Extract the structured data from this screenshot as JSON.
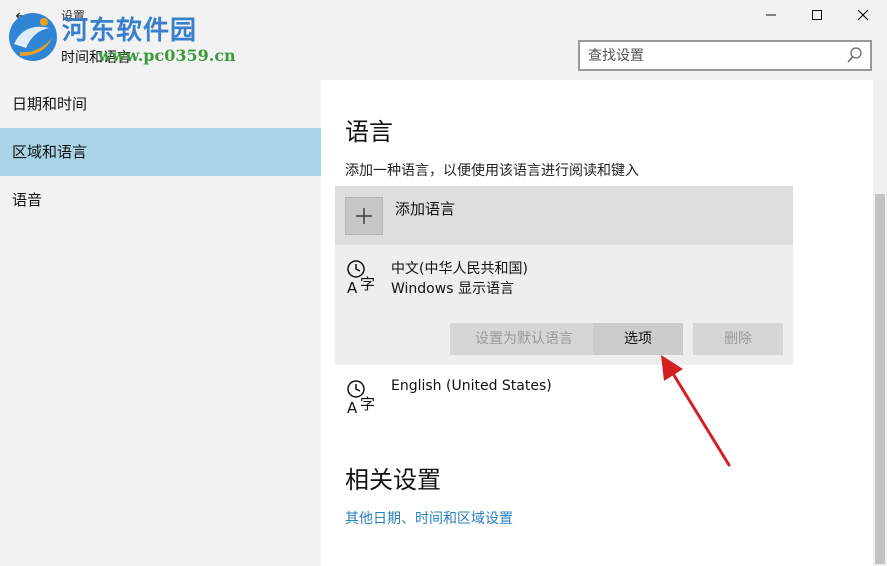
{
  "window": {
    "app_title": "设置",
    "page_name": "时间和语言",
    "back_icon": "back-arrow-icon",
    "minimize_icon": "minimize-icon",
    "maximize_icon": "maximize-icon",
    "close_icon": "close-icon"
  },
  "search": {
    "placeholder": "查找设置",
    "icon": "search-icon"
  },
  "watermark": {
    "name": "河东软件园",
    "url": "www.pc0359.cn"
  },
  "sidebar": {
    "items": [
      {
        "label": "日期和时间",
        "selected": false
      },
      {
        "label": "区域和语言",
        "selected": true
      },
      {
        "label": "语音",
        "selected": false
      }
    ],
    "selected_color": "#a8d4e6"
  },
  "main": {
    "languages_heading": "语言",
    "languages_description": "添加一种语言，以便使用该语言进行阅读和键入",
    "add_language_label": "添加语言",
    "languages": [
      {
        "name": "中文(中华人民共和国)",
        "subtitle": "Windows 显示语言",
        "icon": "language-icon",
        "buttons": {
          "set_default": "设置为默认语言",
          "options": "选项",
          "remove": "删除"
        }
      },
      {
        "name": "English (United States)",
        "icon": "language-icon"
      }
    ],
    "related_heading": "相关设置",
    "related_link": "其他日期、时间和区域设置",
    "link_color": "#2a7fc0"
  }
}
